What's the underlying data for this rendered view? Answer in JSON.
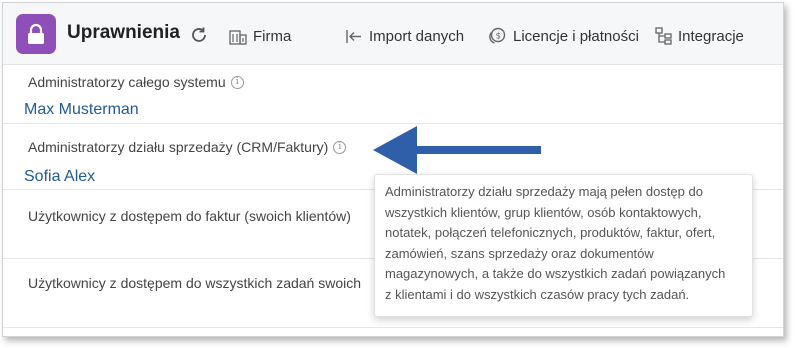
{
  "header": {
    "title": "Uprawnienia",
    "nav": [
      {
        "label": "Firma",
        "icon": "building-icon"
      },
      {
        "label": "Import danych",
        "icon": "import-icon"
      },
      {
        "label": "Licencje i płatności",
        "icon": "coins-icon"
      },
      {
        "label": "Integracje",
        "icon": "integrations-icon"
      }
    ]
  },
  "sections": [
    {
      "label": "Administratorzy całego systemu",
      "users": [
        "Max Musterman"
      ]
    },
    {
      "label": "Administratorzy działu sprzedaży (CRM/Faktury)",
      "users": [
        "Sofia Alex"
      ]
    },
    {
      "label": "Użytkownicy z dostępem do faktur (swoich klientów)",
      "users": []
    },
    {
      "label": "Użytkownicy z dostępem do wszystkich zadań swoich",
      "users": []
    }
  ],
  "tooltip": {
    "lines": [
      "Administratorzy działu sprzedaży mają pełen dostęp do",
      "wszystkich klientów, grup klientów, osób kontaktowych,",
      "notatek, połączeń telefonicznych, produktów, faktur, ofert,",
      "zamówień, szans sprzedaży oraz dokumentów",
      "magazynowych, a także do wszystkich zadań powiązanych",
      "z klientami i do wszystkich czasów pracy tych zadań."
    ]
  },
  "colors": {
    "accent": "#8e4fb8",
    "link": "#1f5a9a",
    "arrow": "#2f5fa8"
  }
}
